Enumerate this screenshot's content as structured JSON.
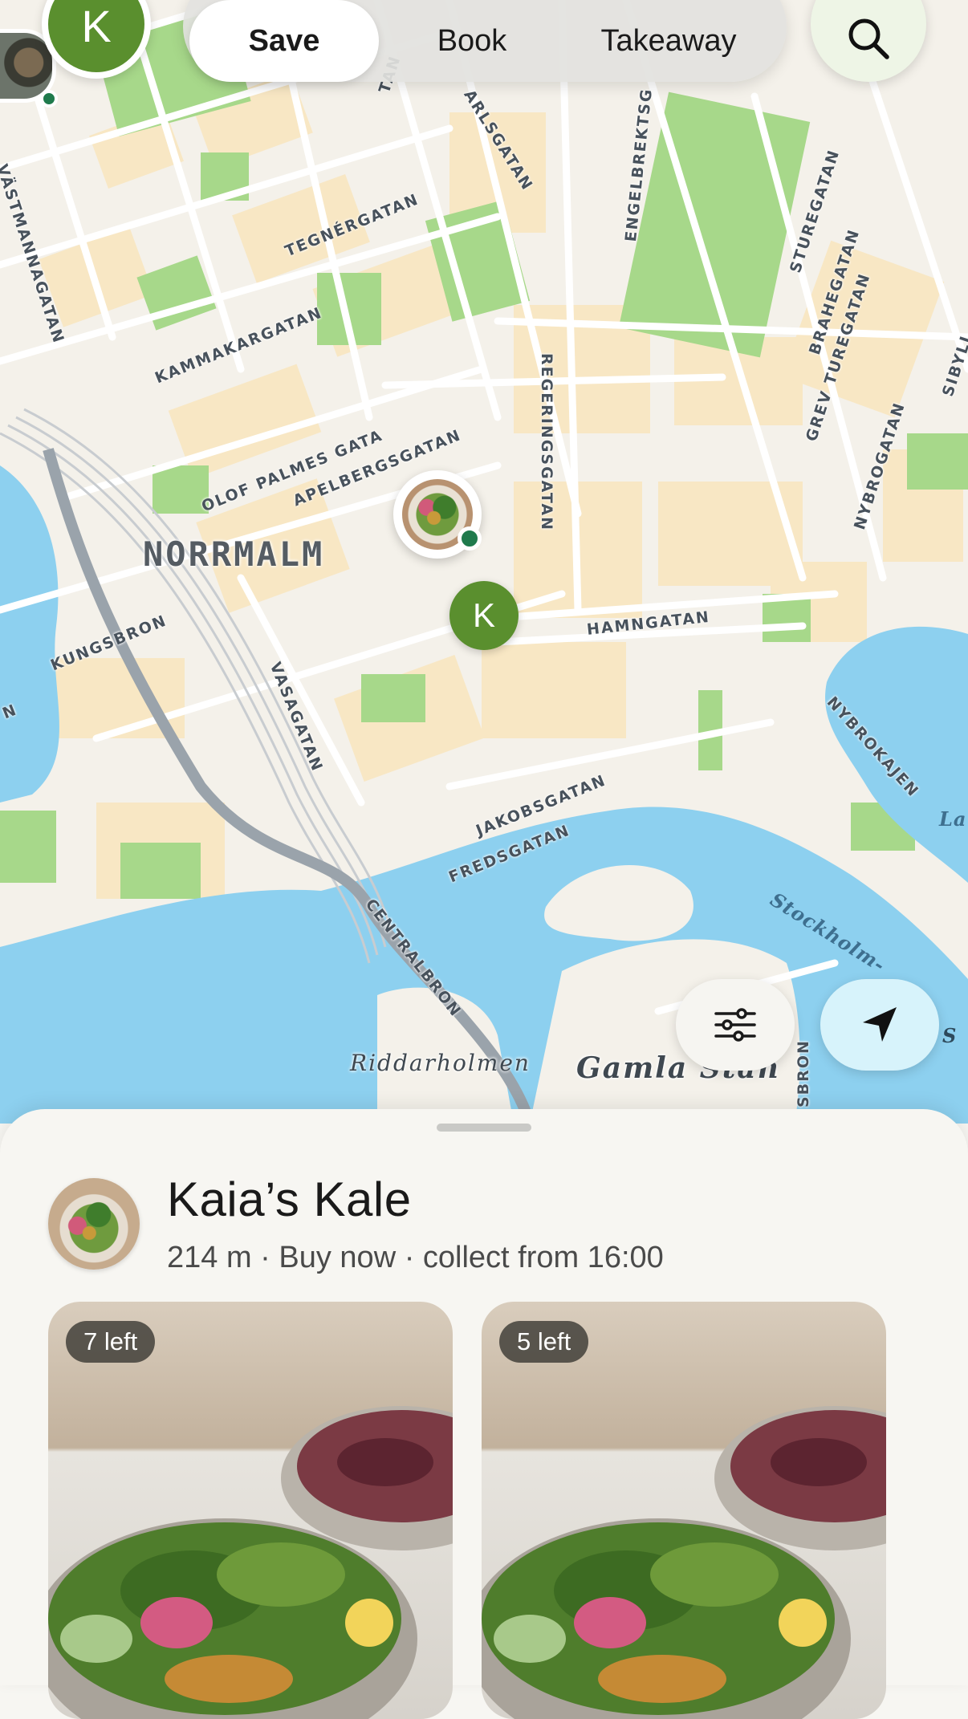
{
  "header": {
    "profile_initial": "K",
    "tabs": [
      {
        "label": "Save",
        "active": true
      },
      {
        "label": "Book",
        "active": false
      },
      {
        "label": "Takeaway",
        "active": false
      }
    ],
    "search_icon": "search-icon"
  },
  "map": {
    "district": "NORRMALM",
    "streets": {
      "vastmannagatan": "VÄSTMANNAGATAN",
      "tegnergatan": "TEGNÉRGATAN",
      "kammakargatan": "KAMMAKARGATAN",
      "olof_palmes": "OLOF PALMES GATA",
      "apelbergsgatan": "APELBERGSGATAN",
      "kungsbron": "KUNGSBRON",
      "vasagatan": "VASAGATAN",
      "hamngatan": "HAMNGATAN",
      "regeringsgatan": "REGERINGSGATAN",
      "engelbrekts": "ENGELBREKTSG",
      "sturegatan": "STUREGATAN",
      "brahegatan": "BRAHEGATAN",
      "grev_turegatan": "GREV TUREGATAN",
      "nybrogatan": "NYBROGATAN",
      "sibyl": "SIBYLL",
      "jakobsgatan": "JAKOBSGATAN",
      "fredsgatan": "FREDSGATAN",
      "centralbron": "CENTRALBRON",
      "nybrokajen": "NYBROKAJEN",
      "karlsgatan": "ARLSGATAN",
      "tan": "TAN",
      "sbron": "SBRON",
      "n_left": "N"
    },
    "areas": {
      "riddarholmen": "Riddarholmen",
      "gamla_stan": "Gamla Stan"
    },
    "water": {
      "stockholm": "Stockholm-",
      "la": "La",
      "s": "S"
    },
    "user_pin_initial": "K",
    "filter_icon": "sliders-icon",
    "locate_icon": "location-arrow-icon"
  },
  "store": {
    "name": "Kaia’s Kale",
    "meta": "214 m · Buy now · collect from 16:00",
    "bags": [
      {
        "badge": "7 left"
      },
      {
        "badge": "5 left"
      }
    ]
  }
}
